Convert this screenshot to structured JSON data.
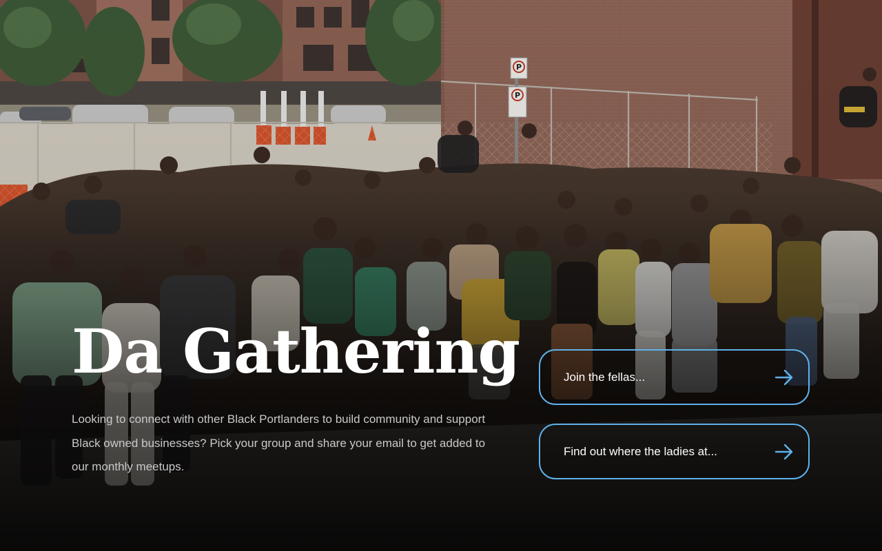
{
  "hero": {
    "title": "Da Gathering",
    "description": "Looking to connect with other Black Portlanders to build community and support Black owned businesses? Pick your group and share your email to get added to our monthly meetups."
  },
  "buttons": [
    {
      "label": "Join the fellas...",
      "icon": "arrow-right-icon"
    },
    {
      "label": "Find out where the ladies at...",
      "icon": "arrow-right-icon"
    }
  ],
  "background": {
    "signs": [
      "P",
      "P"
    ]
  },
  "colors": {
    "accent": "#5fb2ea",
    "title": "#ffffff",
    "body_text": "#c9c9c9"
  }
}
